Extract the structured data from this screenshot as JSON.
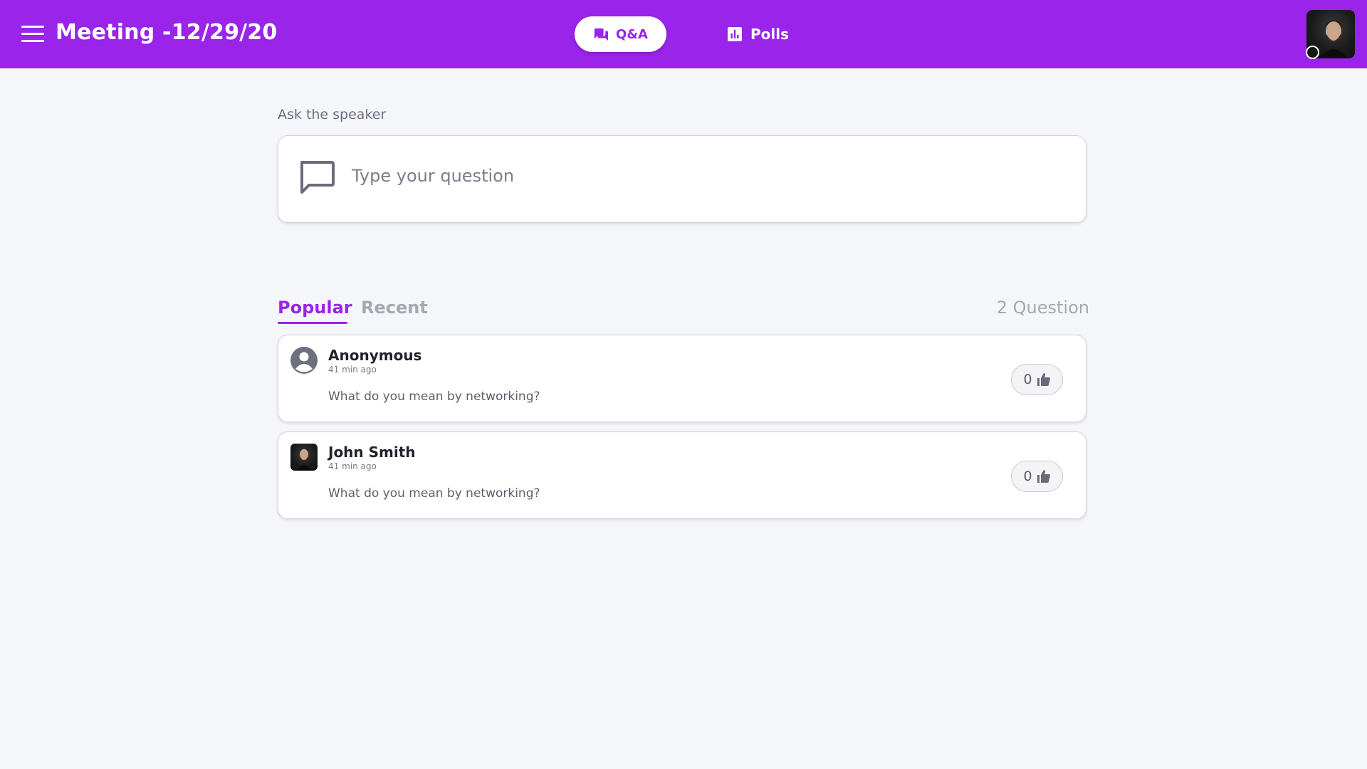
{
  "header": {
    "title": "Meeting -12/29/20",
    "tabs": [
      {
        "label": "Q&A",
        "icon": "forum-icon",
        "active": true
      },
      {
        "label": "Polls",
        "icon": "poll-icon",
        "active": false
      }
    ]
  },
  "ask": {
    "label": "Ask the speaker",
    "placeholder": "Type your question"
  },
  "list": {
    "tabs": [
      {
        "label": "Popular",
        "active": true
      },
      {
        "label": "Recent",
        "active": false
      }
    ],
    "count_label": "2 Question"
  },
  "questions": [
    {
      "author": "Anonymous",
      "time": "41 min ago",
      "text": "What do you mean by networking?",
      "likes": "0",
      "avatar": "person-icon"
    },
    {
      "author": "John Smith",
      "time": "41 min ago",
      "text": "What do you mean by networking?",
      "likes": "0",
      "avatar": "photo"
    }
  ],
  "colors": {
    "brand": "#9a24ea",
    "background": "#f5f6fa",
    "muted": "#a7a7b2"
  }
}
